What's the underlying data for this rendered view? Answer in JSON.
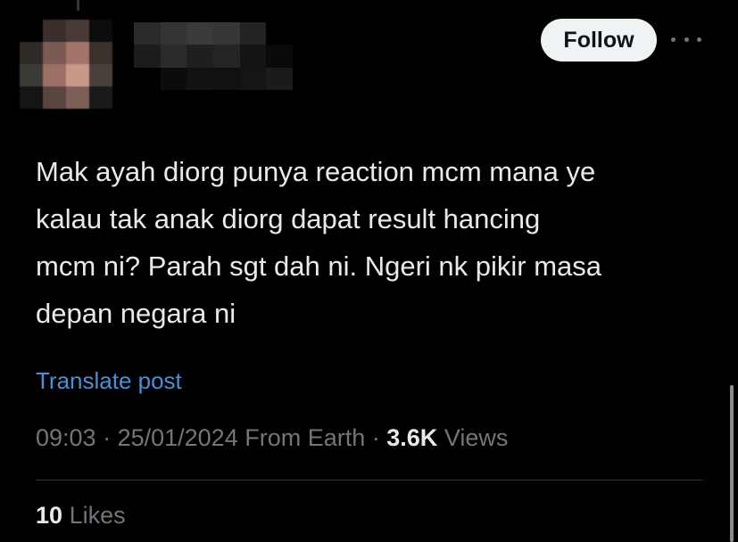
{
  "author": {
    "avatar_icon": "blurred-avatar-icon",
    "name_hidden": true
  },
  "header": {
    "follow_label": "Follow",
    "more_icon": "more-horizontal-icon"
  },
  "post": {
    "text_lines": [
      "Mak ayah diorg punya reaction mcm mana ye",
      "kalau tak anak diorg dapat result hancing",
      "mcm ni? Parah sgt dah ni. Ngeri nk pikir masa",
      "depan negara ni"
    ],
    "translate_label": "Translate post"
  },
  "meta": {
    "time": "09:03",
    "separator": " · ",
    "date": "25/01/2024",
    "source": "From Earth",
    "views_count": "3.6K",
    "views_label": "Views"
  },
  "engagement": {
    "likes_count": "10",
    "likes_label": "Likes"
  },
  "colors": {
    "background": "#000000",
    "text_primary": "#e7e9ea",
    "text_secondary": "#71767b",
    "link": "#1d9bf0",
    "follow_bg": "#eff3f4"
  }
}
